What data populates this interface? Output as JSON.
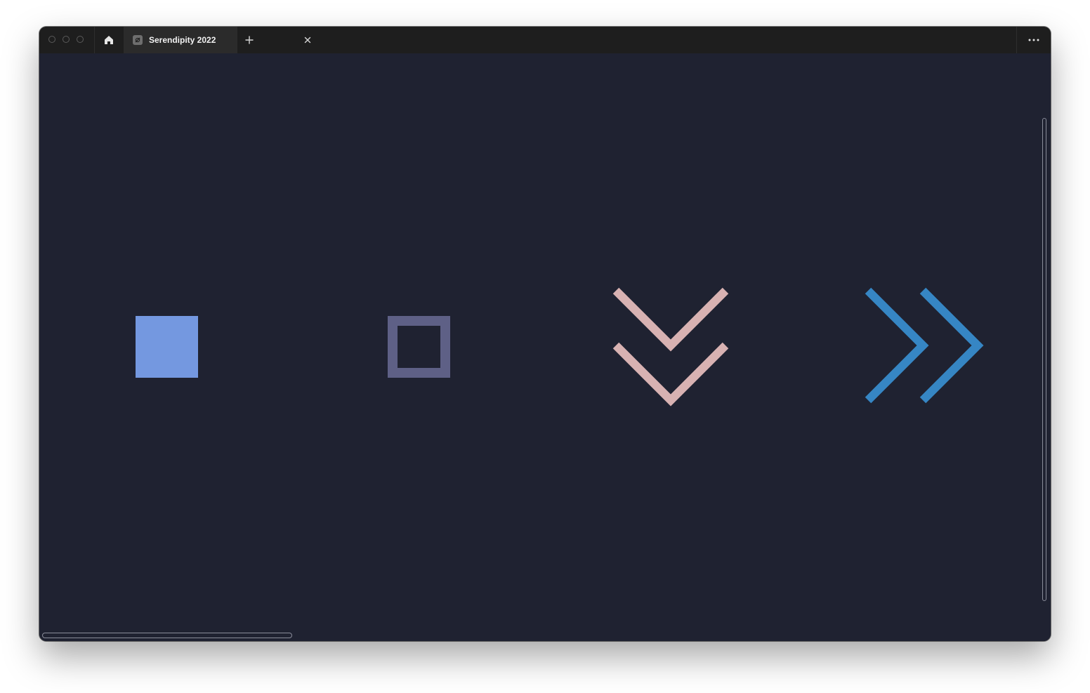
{
  "window": {
    "title_tab": {
      "label": "Serendipity 2022",
      "favicon": "figma-file-icon",
      "close_icon": "close-icon"
    },
    "home_icon": "home-icon",
    "new_tab_icon": "plus-icon",
    "menu_icon": "more-horizontal-icon",
    "traffic_lights": [
      "close",
      "minimize",
      "zoom"
    ]
  },
  "canvas": {
    "background": "#1f2231",
    "shapes": [
      {
        "name": "filled-square-shape",
        "color": "#7498e0"
      },
      {
        "name": "outline-square-shape",
        "color": "#5e6086"
      },
      {
        "name": "double-chevron-down-shape",
        "color": "#d8b2b2"
      },
      {
        "name": "double-chevron-right-shape",
        "color": "#3686c4"
      }
    ]
  }
}
